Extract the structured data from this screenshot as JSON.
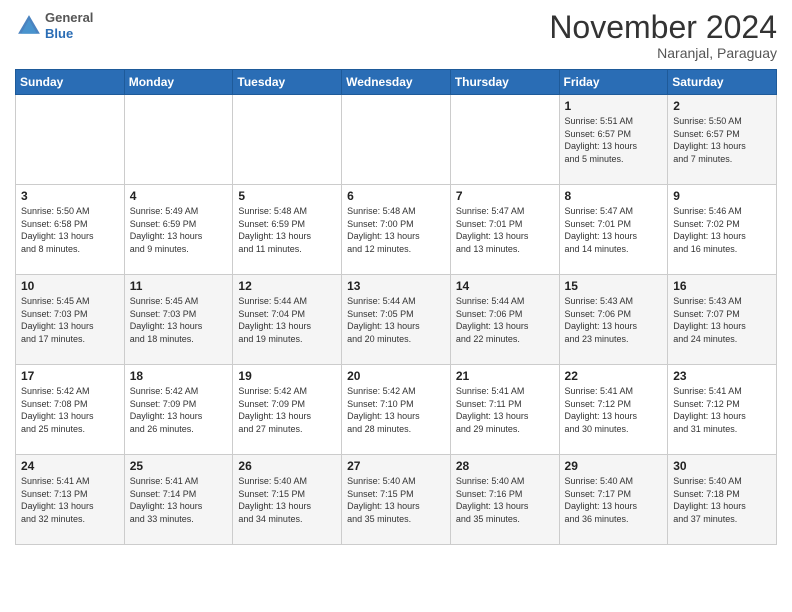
{
  "header": {
    "logo_line1": "General",
    "logo_line2": "Blue",
    "month": "November 2024",
    "location": "Naranjal, Paraguay"
  },
  "weekdays": [
    "Sunday",
    "Monday",
    "Tuesday",
    "Wednesday",
    "Thursday",
    "Friday",
    "Saturday"
  ],
  "weeks": [
    [
      {
        "day": "",
        "info": ""
      },
      {
        "day": "",
        "info": ""
      },
      {
        "day": "",
        "info": ""
      },
      {
        "day": "",
        "info": ""
      },
      {
        "day": "",
        "info": ""
      },
      {
        "day": "1",
        "info": "Sunrise: 5:51 AM\nSunset: 6:57 PM\nDaylight: 13 hours\nand 5 minutes."
      },
      {
        "day": "2",
        "info": "Sunrise: 5:50 AM\nSunset: 6:57 PM\nDaylight: 13 hours\nand 7 minutes."
      }
    ],
    [
      {
        "day": "3",
        "info": "Sunrise: 5:50 AM\nSunset: 6:58 PM\nDaylight: 13 hours\nand 8 minutes."
      },
      {
        "day": "4",
        "info": "Sunrise: 5:49 AM\nSunset: 6:59 PM\nDaylight: 13 hours\nand 9 minutes."
      },
      {
        "day": "5",
        "info": "Sunrise: 5:48 AM\nSunset: 6:59 PM\nDaylight: 13 hours\nand 11 minutes."
      },
      {
        "day": "6",
        "info": "Sunrise: 5:48 AM\nSunset: 7:00 PM\nDaylight: 13 hours\nand 12 minutes."
      },
      {
        "day": "7",
        "info": "Sunrise: 5:47 AM\nSunset: 7:01 PM\nDaylight: 13 hours\nand 13 minutes."
      },
      {
        "day": "8",
        "info": "Sunrise: 5:47 AM\nSunset: 7:01 PM\nDaylight: 13 hours\nand 14 minutes."
      },
      {
        "day": "9",
        "info": "Sunrise: 5:46 AM\nSunset: 7:02 PM\nDaylight: 13 hours\nand 16 minutes."
      }
    ],
    [
      {
        "day": "10",
        "info": "Sunrise: 5:45 AM\nSunset: 7:03 PM\nDaylight: 13 hours\nand 17 minutes."
      },
      {
        "day": "11",
        "info": "Sunrise: 5:45 AM\nSunset: 7:03 PM\nDaylight: 13 hours\nand 18 minutes."
      },
      {
        "day": "12",
        "info": "Sunrise: 5:44 AM\nSunset: 7:04 PM\nDaylight: 13 hours\nand 19 minutes."
      },
      {
        "day": "13",
        "info": "Sunrise: 5:44 AM\nSunset: 7:05 PM\nDaylight: 13 hours\nand 20 minutes."
      },
      {
        "day": "14",
        "info": "Sunrise: 5:44 AM\nSunset: 7:06 PM\nDaylight: 13 hours\nand 22 minutes."
      },
      {
        "day": "15",
        "info": "Sunrise: 5:43 AM\nSunset: 7:06 PM\nDaylight: 13 hours\nand 23 minutes."
      },
      {
        "day": "16",
        "info": "Sunrise: 5:43 AM\nSunset: 7:07 PM\nDaylight: 13 hours\nand 24 minutes."
      }
    ],
    [
      {
        "day": "17",
        "info": "Sunrise: 5:42 AM\nSunset: 7:08 PM\nDaylight: 13 hours\nand 25 minutes."
      },
      {
        "day": "18",
        "info": "Sunrise: 5:42 AM\nSunset: 7:09 PM\nDaylight: 13 hours\nand 26 minutes."
      },
      {
        "day": "19",
        "info": "Sunrise: 5:42 AM\nSunset: 7:09 PM\nDaylight: 13 hours\nand 27 minutes."
      },
      {
        "day": "20",
        "info": "Sunrise: 5:42 AM\nSunset: 7:10 PM\nDaylight: 13 hours\nand 28 minutes."
      },
      {
        "day": "21",
        "info": "Sunrise: 5:41 AM\nSunset: 7:11 PM\nDaylight: 13 hours\nand 29 minutes."
      },
      {
        "day": "22",
        "info": "Sunrise: 5:41 AM\nSunset: 7:12 PM\nDaylight: 13 hours\nand 30 minutes."
      },
      {
        "day": "23",
        "info": "Sunrise: 5:41 AM\nSunset: 7:12 PM\nDaylight: 13 hours\nand 31 minutes."
      }
    ],
    [
      {
        "day": "24",
        "info": "Sunrise: 5:41 AM\nSunset: 7:13 PM\nDaylight: 13 hours\nand 32 minutes."
      },
      {
        "day": "25",
        "info": "Sunrise: 5:41 AM\nSunset: 7:14 PM\nDaylight: 13 hours\nand 33 minutes."
      },
      {
        "day": "26",
        "info": "Sunrise: 5:40 AM\nSunset: 7:15 PM\nDaylight: 13 hours\nand 34 minutes."
      },
      {
        "day": "27",
        "info": "Sunrise: 5:40 AM\nSunset: 7:15 PM\nDaylight: 13 hours\nand 35 minutes."
      },
      {
        "day": "28",
        "info": "Sunrise: 5:40 AM\nSunset: 7:16 PM\nDaylight: 13 hours\nand 35 minutes."
      },
      {
        "day": "29",
        "info": "Sunrise: 5:40 AM\nSunset: 7:17 PM\nDaylight: 13 hours\nand 36 minutes."
      },
      {
        "day": "30",
        "info": "Sunrise: 5:40 AM\nSunset: 7:18 PM\nDaylight: 13 hours\nand 37 minutes."
      }
    ]
  ]
}
